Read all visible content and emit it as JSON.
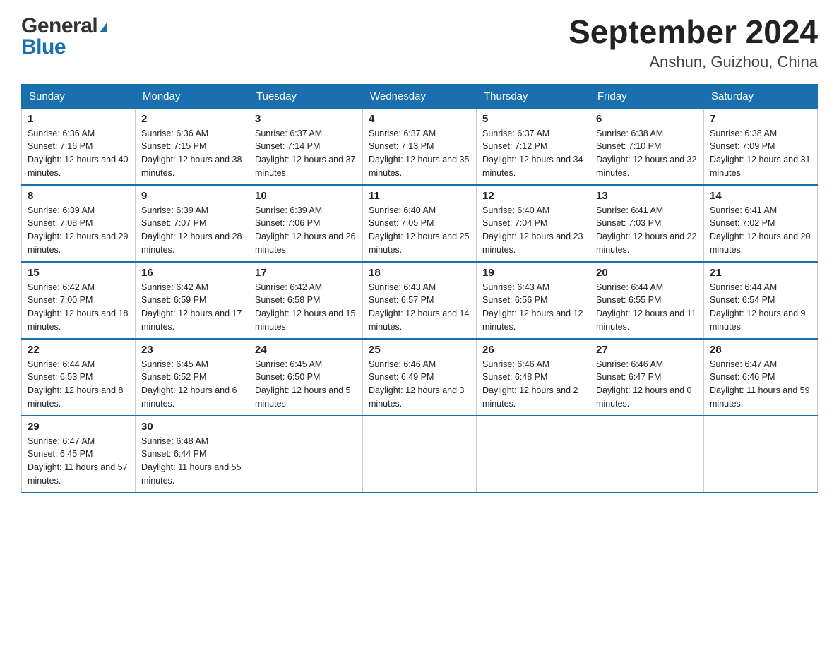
{
  "header": {
    "title": "September 2024",
    "subtitle": "Anshun, Guizhou, China",
    "logo_line1": "General",
    "logo_line2": "Blue"
  },
  "columns": [
    "Sunday",
    "Monday",
    "Tuesday",
    "Wednesday",
    "Thursday",
    "Friday",
    "Saturday"
  ],
  "weeks": [
    [
      {
        "day": "1",
        "sunrise": "Sunrise: 6:36 AM",
        "sunset": "Sunset: 7:16 PM",
        "daylight": "Daylight: 12 hours and 40 minutes."
      },
      {
        "day": "2",
        "sunrise": "Sunrise: 6:36 AM",
        "sunset": "Sunset: 7:15 PM",
        "daylight": "Daylight: 12 hours and 38 minutes."
      },
      {
        "day": "3",
        "sunrise": "Sunrise: 6:37 AM",
        "sunset": "Sunset: 7:14 PM",
        "daylight": "Daylight: 12 hours and 37 minutes."
      },
      {
        "day": "4",
        "sunrise": "Sunrise: 6:37 AM",
        "sunset": "Sunset: 7:13 PM",
        "daylight": "Daylight: 12 hours and 35 minutes."
      },
      {
        "day": "5",
        "sunrise": "Sunrise: 6:37 AM",
        "sunset": "Sunset: 7:12 PM",
        "daylight": "Daylight: 12 hours and 34 minutes."
      },
      {
        "day": "6",
        "sunrise": "Sunrise: 6:38 AM",
        "sunset": "Sunset: 7:10 PM",
        "daylight": "Daylight: 12 hours and 32 minutes."
      },
      {
        "day": "7",
        "sunrise": "Sunrise: 6:38 AM",
        "sunset": "Sunset: 7:09 PM",
        "daylight": "Daylight: 12 hours and 31 minutes."
      }
    ],
    [
      {
        "day": "8",
        "sunrise": "Sunrise: 6:39 AM",
        "sunset": "Sunset: 7:08 PM",
        "daylight": "Daylight: 12 hours and 29 minutes."
      },
      {
        "day": "9",
        "sunrise": "Sunrise: 6:39 AM",
        "sunset": "Sunset: 7:07 PM",
        "daylight": "Daylight: 12 hours and 28 minutes."
      },
      {
        "day": "10",
        "sunrise": "Sunrise: 6:39 AM",
        "sunset": "Sunset: 7:06 PM",
        "daylight": "Daylight: 12 hours and 26 minutes."
      },
      {
        "day": "11",
        "sunrise": "Sunrise: 6:40 AM",
        "sunset": "Sunset: 7:05 PM",
        "daylight": "Daylight: 12 hours and 25 minutes."
      },
      {
        "day": "12",
        "sunrise": "Sunrise: 6:40 AM",
        "sunset": "Sunset: 7:04 PM",
        "daylight": "Daylight: 12 hours and 23 minutes."
      },
      {
        "day": "13",
        "sunrise": "Sunrise: 6:41 AM",
        "sunset": "Sunset: 7:03 PM",
        "daylight": "Daylight: 12 hours and 22 minutes."
      },
      {
        "day": "14",
        "sunrise": "Sunrise: 6:41 AM",
        "sunset": "Sunset: 7:02 PM",
        "daylight": "Daylight: 12 hours and 20 minutes."
      }
    ],
    [
      {
        "day": "15",
        "sunrise": "Sunrise: 6:42 AM",
        "sunset": "Sunset: 7:00 PM",
        "daylight": "Daylight: 12 hours and 18 minutes."
      },
      {
        "day": "16",
        "sunrise": "Sunrise: 6:42 AM",
        "sunset": "Sunset: 6:59 PM",
        "daylight": "Daylight: 12 hours and 17 minutes."
      },
      {
        "day": "17",
        "sunrise": "Sunrise: 6:42 AM",
        "sunset": "Sunset: 6:58 PM",
        "daylight": "Daylight: 12 hours and 15 minutes."
      },
      {
        "day": "18",
        "sunrise": "Sunrise: 6:43 AM",
        "sunset": "Sunset: 6:57 PM",
        "daylight": "Daylight: 12 hours and 14 minutes."
      },
      {
        "day": "19",
        "sunrise": "Sunrise: 6:43 AM",
        "sunset": "Sunset: 6:56 PM",
        "daylight": "Daylight: 12 hours and 12 minutes."
      },
      {
        "day": "20",
        "sunrise": "Sunrise: 6:44 AM",
        "sunset": "Sunset: 6:55 PM",
        "daylight": "Daylight: 12 hours and 11 minutes."
      },
      {
        "day": "21",
        "sunrise": "Sunrise: 6:44 AM",
        "sunset": "Sunset: 6:54 PM",
        "daylight": "Daylight: 12 hours and 9 minutes."
      }
    ],
    [
      {
        "day": "22",
        "sunrise": "Sunrise: 6:44 AM",
        "sunset": "Sunset: 6:53 PM",
        "daylight": "Daylight: 12 hours and 8 minutes."
      },
      {
        "day": "23",
        "sunrise": "Sunrise: 6:45 AM",
        "sunset": "Sunset: 6:52 PM",
        "daylight": "Daylight: 12 hours and 6 minutes."
      },
      {
        "day": "24",
        "sunrise": "Sunrise: 6:45 AM",
        "sunset": "Sunset: 6:50 PM",
        "daylight": "Daylight: 12 hours and 5 minutes."
      },
      {
        "day": "25",
        "sunrise": "Sunrise: 6:46 AM",
        "sunset": "Sunset: 6:49 PM",
        "daylight": "Daylight: 12 hours and 3 minutes."
      },
      {
        "day": "26",
        "sunrise": "Sunrise: 6:46 AM",
        "sunset": "Sunset: 6:48 PM",
        "daylight": "Daylight: 12 hours and 2 minutes."
      },
      {
        "day": "27",
        "sunrise": "Sunrise: 6:46 AM",
        "sunset": "Sunset: 6:47 PM",
        "daylight": "Daylight: 12 hours and 0 minutes."
      },
      {
        "day": "28",
        "sunrise": "Sunrise: 6:47 AM",
        "sunset": "Sunset: 6:46 PM",
        "daylight": "Daylight: 11 hours and 59 minutes."
      }
    ],
    [
      {
        "day": "29",
        "sunrise": "Sunrise: 6:47 AM",
        "sunset": "Sunset: 6:45 PM",
        "daylight": "Daylight: 11 hours and 57 minutes."
      },
      {
        "day": "30",
        "sunrise": "Sunrise: 6:48 AM",
        "sunset": "Sunset: 6:44 PM",
        "daylight": "Daylight: 11 hours and 55 minutes."
      },
      null,
      null,
      null,
      null,
      null
    ]
  ]
}
